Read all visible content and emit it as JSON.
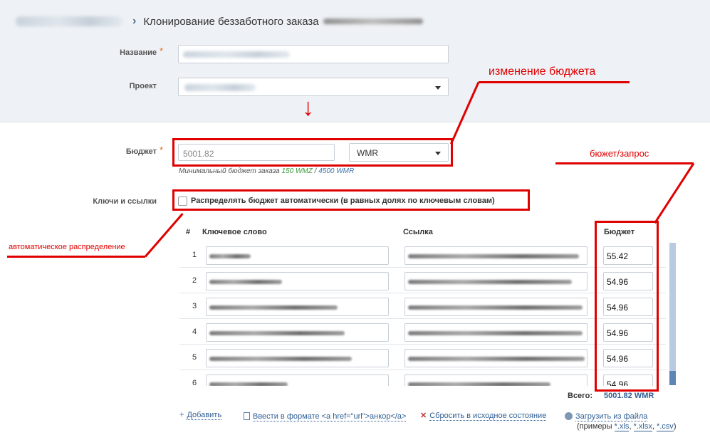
{
  "breadcrumb": {
    "separator": "›",
    "title": "Клонирование беззаботного заказа"
  },
  "form": {
    "name_label": "Название",
    "project_label": "Проект",
    "budget_label": "Бюджет",
    "required_mark": "*",
    "budget_value": "5001.82",
    "currency_value": "WMR",
    "hint_prefix": "Минимальный бюджет заказа",
    "hint_wmz": "150 WMZ",
    "hint_slash": " / ",
    "hint_wmr": "4500 WMR",
    "keys_label": "Ключи и ссылки",
    "auto_distribute_label": "Распределять бюджет автоматически (в равных долях по ключевым словам)"
  },
  "annotations": {
    "budget_change": "изменение бюджета",
    "budget_per_query": "бюжет/запрос",
    "auto_distribution": "автоматическое распределение",
    "arrow": "↓",
    "color": "#e00000"
  },
  "table": {
    "headers": {
      "num": "#",
      "keyword": "Ключевое слово",
      "link": "Ссылка",
      "budget": "Бюджет"
    },
    "rows": [
      {
        "num": "1",
        "budget": "55.42"
      },
      {
        "num": "2",
        "budget": "54.96"
      },
      {
        "num": "3",
        "budget": "54.96"
      },
      {
        "num": "4",
        "budget": "54.96"
      },
      {
        "num": "5",
        "budget": "54.96"
      },
      {
        "num": "6",
        "budget": "54.96"
      }
    ],
    "total_label": "Всего:",
    "total_value": "5001.82 WMR"
  },
  "actions": {
    "add": "Добавить",
    "add_icon": "plus-icon",
    "enter_format": "Ввести в формате <a href=\"url\">анкор</a>",
    "reset": "Сбросить в исходное состояние",
    "upload": "Загрузить из файла",
    "examples_prefix": "(примеры ",
    "ex_xls": "*.xls",
    "ex_xlsx": "*.xlsx",
    "ex_csv": "*.csv",
    "examples_suffix": ")",
    "comma": ", "
  }
}
